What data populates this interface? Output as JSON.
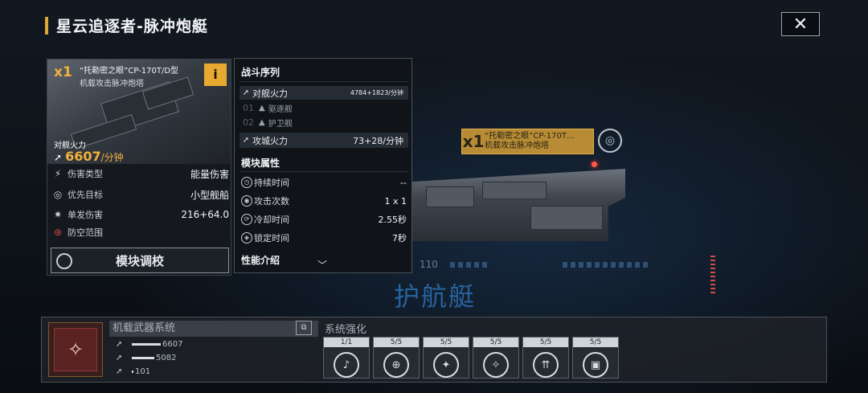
{
  "header": {
    "title": "星云追逐者-脉冲炮艇",
    "close_label": "✕"
  },
  "ship": {
    "tag_count": "x1",
    "tag_name": "“托勒密之眼”CP-170T…",
    "tag_sub": "机载攻击脉冲炮塔",
    "hull_number": "110",
    "type_label": "护航艇"
  },
  "card": {
    "count": "x1",
    "name": "“托勒密之眼”CP-170T/D型",
    "subtitle": "机载攻击脉冲炮塔",
    "info_label": "i",
    "firepower_label": "对舰火力",
    "firepower_value": "6607",
    "firepower_unit": "/分钟",
    "stats": [
      {
        "label": "伤害类型",
        "value": "能量伤害",
        "icon": "damage-type-icon"
      },
      {
        "label": "优先目标",
        "value": "小型舰船",
        "icon": "target-icon"
      },
      {
        "label": "单发伤害",
        "value": "216+64.0",
        "icon": "single-damage-icon"
      },
      {
        "label": "防空范围",
        "value": "",
        "icon": "anti-air-icon"
      }
    ],
    "tune_label": "模块调校"
  },
  "panel": {
    "battle_title": "战斗序列",
    "ship_fire_label": "对舰火力",
    "ship_fire_value": "4784+1823/分钟",
    "seq": [
      {
        "num": "01",
        "label": "驱逐舰"
      },
      {
        "num": "02",
        "label": "护卫舰"
      }
    ],
    "siege_label": "攻城火力",
    "siege_value": "73+28/分钟",
    "attr_title": "模块属性",
    "attrs": [
      {
        "label": "持续时间",
        "value": "--"
      },
      {
        "label": "攻击次数",
        "value": "1 x 1"
      },
      {
        "label": "冷却时间",
        "value": "2.55秒"
      },
      {
        "label": "锁定时间",
        "value": "7秒"
      }
    ],
    "perf_title": "性能介绍"
  },
  "bottom": {
    "weapon_sys_title": "机载武器系统",
    "wstats": [
      "6607",
      "5082",
      "101"
    ],
    "sys_title": "系统强化",
    "slots": [
      "1/1",
      "5/5",
      "5/5",
      "5/5",
      "5/5",
      "5/5"
    ]
  },
  "colors": {
    "accent": "#f0b13f",
    "info": "#e8a930",
    "ship_type": "#2d6fb0"
  }
}
